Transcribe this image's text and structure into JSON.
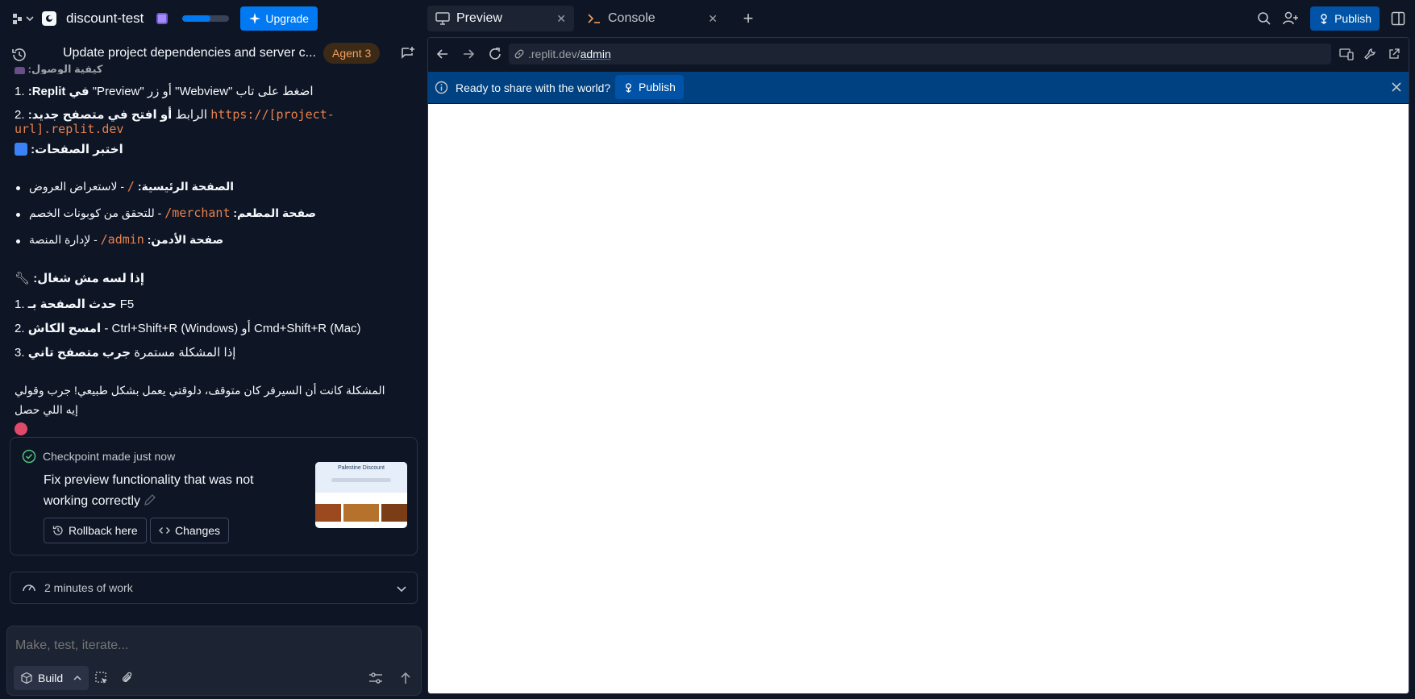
{
  "topbar": {
    "project_name": "discount-test",
    "upgrade_label": "Upgrade",
    "usage_fraction": 0.6,
    "tabs": [
      {
        "label": "Preview",
        "active": true
      },
      {
        "label": "Console",
        "active": false
      }
    ],
    "publish_label": "Publish"
  },
  "chat": {
    "title": "Update project dependencies and server c...",
    "agent_badge": "Agent 3",
    "lines": {
      "access_heading": "كيفية الوصول:",
      "step1_num": "1.",
      "step1_bold": "في Replit:",
      "step1_text": "اضغط على تاب \"Webview\" أو زر \"Preview\"",
      "step2_num": "2.",
      "step2_bold": "أو افتح في متصفح جديد:",
      "step2_text": "الرابط",
      "step2_url": "https://[project-url].replit.dev",
      "test_heading": "اختبر الصفحات:",
      "page1_bold": "الصفحة الرئيسية:",
      "page1_path": "/",
      "page1_text": "- لاستعراض العروض",
      "page2_bold": "صفحة المطعم:",
      "page2_path": "/merchant",
      "page2_text": "- للتحقق من كوبونات الخصم",
      "page3_bold": "صفحة الأدمن:",
      "page3_path": "/admin",
      "page3_text": "- لإدارة المنصة",
      "fix_heading": "إذا لسه مش شغال:",
      "fix1_num": "1.",
      "fix1_bold": "حدث الصفحة بـ",
      "fix1_text": "F5",
      "fix2_num": "2.",
      "fix2_bold": "امسح الكاش",
      "fix2_text": "- Ctrl+Shift+R (Windows) أو Cmd+Shift+R (Mac)",
      "fix3_num": "3.",
      "fix3_bold": "جرب متصفح تاني",
      "fix3_text": "إذا المشكلة مستمرة",
      "closing": "المشكلة كانت أن السيرفر كان متوقف، دلوقتي يعمل بشكل طبيعي! جرب وقولي إيه اللي حصل"
    },
    "checkpoint": {
      "header": "Checkpoint made just now",
      "title": "Fix preview functionality that was not working correctly",
      "rollback_label": "Rollback here",
      "changes_label": "Changes",
      "thumb_title": "Palestine Discount"
    },
    "work_summary": "2 minutes of work",
    "composer": {
      "placeholder": "Make, test, iterate...",
      "mode_label": "Build"
    }
  },
  "preview": {
    "url_host": ".replit.dev/",
    "url_path": "admin",
    "banner_text": "Ready to share with the world?",
    "banner_button": "Publish"
  }
}
